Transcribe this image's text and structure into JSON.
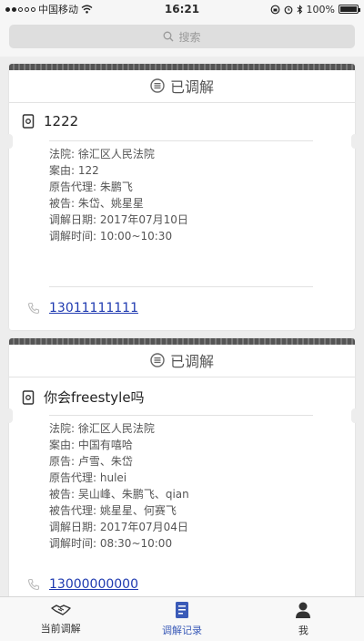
{
  "status_bar": {
    "carrier": "中国移动",
    "time": "16:21",
    "battery_text": "100%",
    "battery_level": 1.0
  },
  "search": {
    "placeholder": "搜索"
  },
  "records": [
    {
      "status": "已调解",
      "title": "1222",
      "fields": [
        "法院: 徐汇区人民法院",
        "案由: 122",
        "原告代理: 朱鹏飞",
        "被告: 朱岱、姚星星",
        "调解日期: 2017年07月10日",
        "调解时间: 10:00~10:30"
      ],
      "phone": "13011111111"
    },
    {
      "status": "已调解",
      "title": "你会freestyle吗",
      "fields": [
        "法院: 徐汇区人民法院",
        "案由: 中国有嘻哈",
        "原告: 卢雪、朱岱",
        "原告代理: hulei",
        "被告: 吴山峰、朱鹏飞、qian",
        "被告代理: 姚星星、何赛飞",
        "调解日期: 2017年07月04日",
        "调解时间: 08:30~10:00"
      ],
      "phone": "13000000000"
    }
  ],
  "tabs": [
    {
      "label": "当前调解",
      "icon": "handshake-icon",
      "active": false
    },
    {
      "label": "调解记录",
      "icon": "document-icon",
      "active": true
    },
    {
      "label": "我",
      "icon": "person-icon",
      "active": false
    }
  ],
  "colors": {
    "accent": "#3b5bb8",
    "link": "#1f3ab0",
    "background": "#ededed"
  }
}
